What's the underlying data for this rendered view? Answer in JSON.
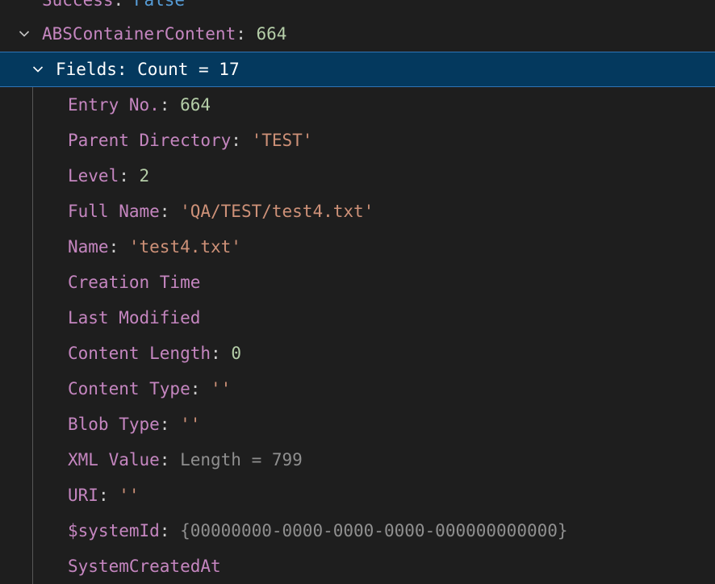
{
  "tree": {
    "clipped_row": {
      "key": "Success",
      "sep": ": ",
      "value": "False"
    },
    "container_row": {
      "key": "ABSContainerContent",
      "sep": ": ",
      "value": "664"
    },
    "fields_row": {
      "key": "Fields",
      "sep": ": ",
      "value": "Count = 17"
    },
    "fields": [
      {
        "key": "Entry No.",
        "sep": ": ",
        "value": "664",
        "type": "num"
      },
      {
        "key": "Parent Directory",
        "sep": ": ",
        "value": "'TEST'",
        "type": "str"
      },
      {
        "key": "Level",
        "sep": ": ",
        "value": "2",
        "type": "num"
      },
      {
        "key": "Full Name",
        "sep": ": ",
        "value": "'QA/TEST/test4.txt'",
        "type": "str"
      },
      {
        "key": "Name",
        "sep": ": ",
        "value": "'test4.txt'",
        "type": "str"
      },
      {
        "key": "Creation Time",
        "sep": "",
        "value": "",
        "type": "none"
      },
      {
        "key": "Last Modified",
        "sep": "",
        "value": "",
        "type": "none"
      },
      {
        "key": "Content Length",
        "sep": ": ",
        "value": "0",
        "type": "num"
      },
      {
        "key": "Content Type",
        "sep": ": ",
        "value": "''",
        "type": "str"
      },
      {
        "key": "Blob Type",
        "sep": ": ",
        "value": "''",
        "type": "str"
      },
      {
        "key": "XML Value",
        "sep": ": ",
        "value": "Length = 799",
        "type": "dim"
      },
      {
        "key": "URI",
        "sep": ": ",
        "value": "''",
        "type": "str"
      },
      {
        "key": "$systemId",
        "sep": ": ",
        "value": "{00000000-0000-0000-0000-000000000000}",
        "type": "dim"
      },
      {
        "key": "SystemCreatedAt",
        "sep": "",
        "value": "",
        "type": "none"
      }
    ]
  },
  "colors": {
    "background": "#1e1e1e",
    "selection": "#04395e",
    "selection_border": "#2f75b7",
    "key": "#c586c0",
    "number": "#b5cea8",
    "string": "#ce9178",
    "boolean": "#569cd6",
    "muted": "#8f8f8f"
  },
  "icons": {
    "expand_chevron": "chevron-down-icon"
  }
}
